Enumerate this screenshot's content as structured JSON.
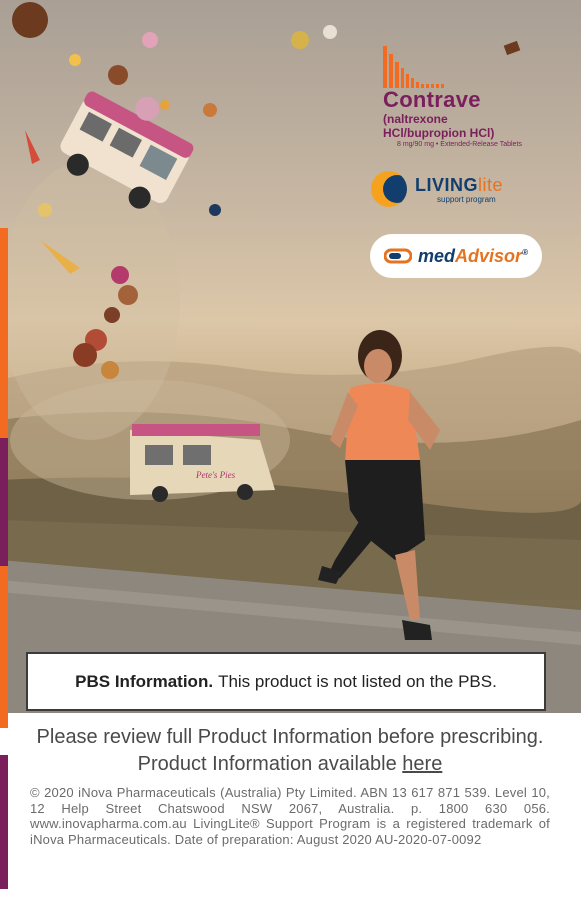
{
  "logos": {
    "contrave": {
      "name": "Contrave",
      "generic": "(naltrexone HCl/bupropion HCl)",
      "dose": "8 mg/90 mg • Extended-Release Tablets"
    },
    "livinglite": {
      "brand_bold": "LIVING",
      "brand_light": "lite",
      "sub": "support program"
    },
    "medadvisor": {
      "med": "med",
      "advisor": "Advisor",
      "mark": "®"
    }
  },
  "pbs": {
    "label": "PBS Information.",
    "text": "This product is not listed on the PBS."
  },
  "review": {
    "line1": "Please review full Product Information before prescribing.",
    "line2_prefix": "Product Information available",
    "link": "here"
  },
  "legal": "© 2020 iNova Pharmaceuticals (Australia) Pty Limited. ABN 13 617 871 539. Level 10, 12 Help Street Chatswood NSW 2067, Australia. p. 1800 630 056. www.inovapharma.com.au LivingLite® Support Program is a registered trademark of iNova Pharmaceuticals. Date of preparation: August 2020 AU-2020-07-0092",
  "van_sign": "Pete's Pies",
  "colors": {
    "orange": "#f26b21",
    "purple": "#7a1f5c",
    "navy": "#123e6e"
  }
}
